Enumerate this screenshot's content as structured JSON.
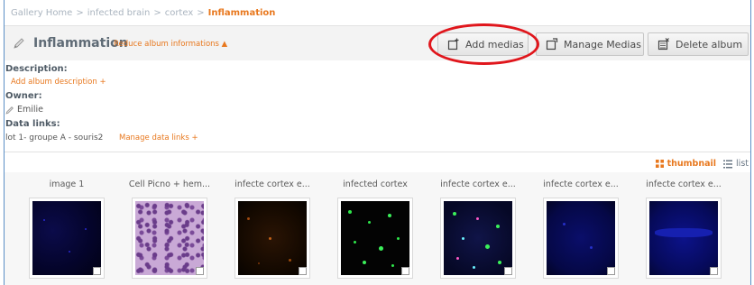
{
  "breadcrumb": {
    "items": [
      "Gallery Home",
      "infected brain",
      "cortex"
    ],
    "current": "Inflammation",
    "separator": ">"
  },
  "album": {
    "title": "Inflammation",
    "reduce_link": "Reduce album informations ▲"
  },
  "toolbar": {
    "add_medias": "Add medias",
    "manage_medias": "Manage Medias",
    "delete_album": "Delete album"
  },
  "info": {
    "description_label": "Description:",
    "add_description_link": "Add album description +",
    "owner_label": "Owner:",
    "owner_name": "Emilie",
    "data_links_label": "Data links:",
    "data_links_value": "lot 1- groupe A - souris2",
    "manage_links": "Manage data links +"
  },
  "view_toggle": {
    "thumbnail": "thumbnail",
    "list": "list"
  },
  "medias": [
    {
      "title": "image 1"
    },
    {
      "title": "Cell Picno + hem..."
    },
    {
      "title": "infecte cortex e..."
    },
    {
      "title": "infected cortex"
    },
    {
      "title": "infecte cortex e..."
    },
    {
      "title": "infecte cortex e..."
    },
    {
      "title": "infecte cortex e..."
    }
  ],
  "colors": {
    "accent": "#e8781e",
    "highlight": "#e0161c",
    "frame": "#5b8fc6"
  }
}
